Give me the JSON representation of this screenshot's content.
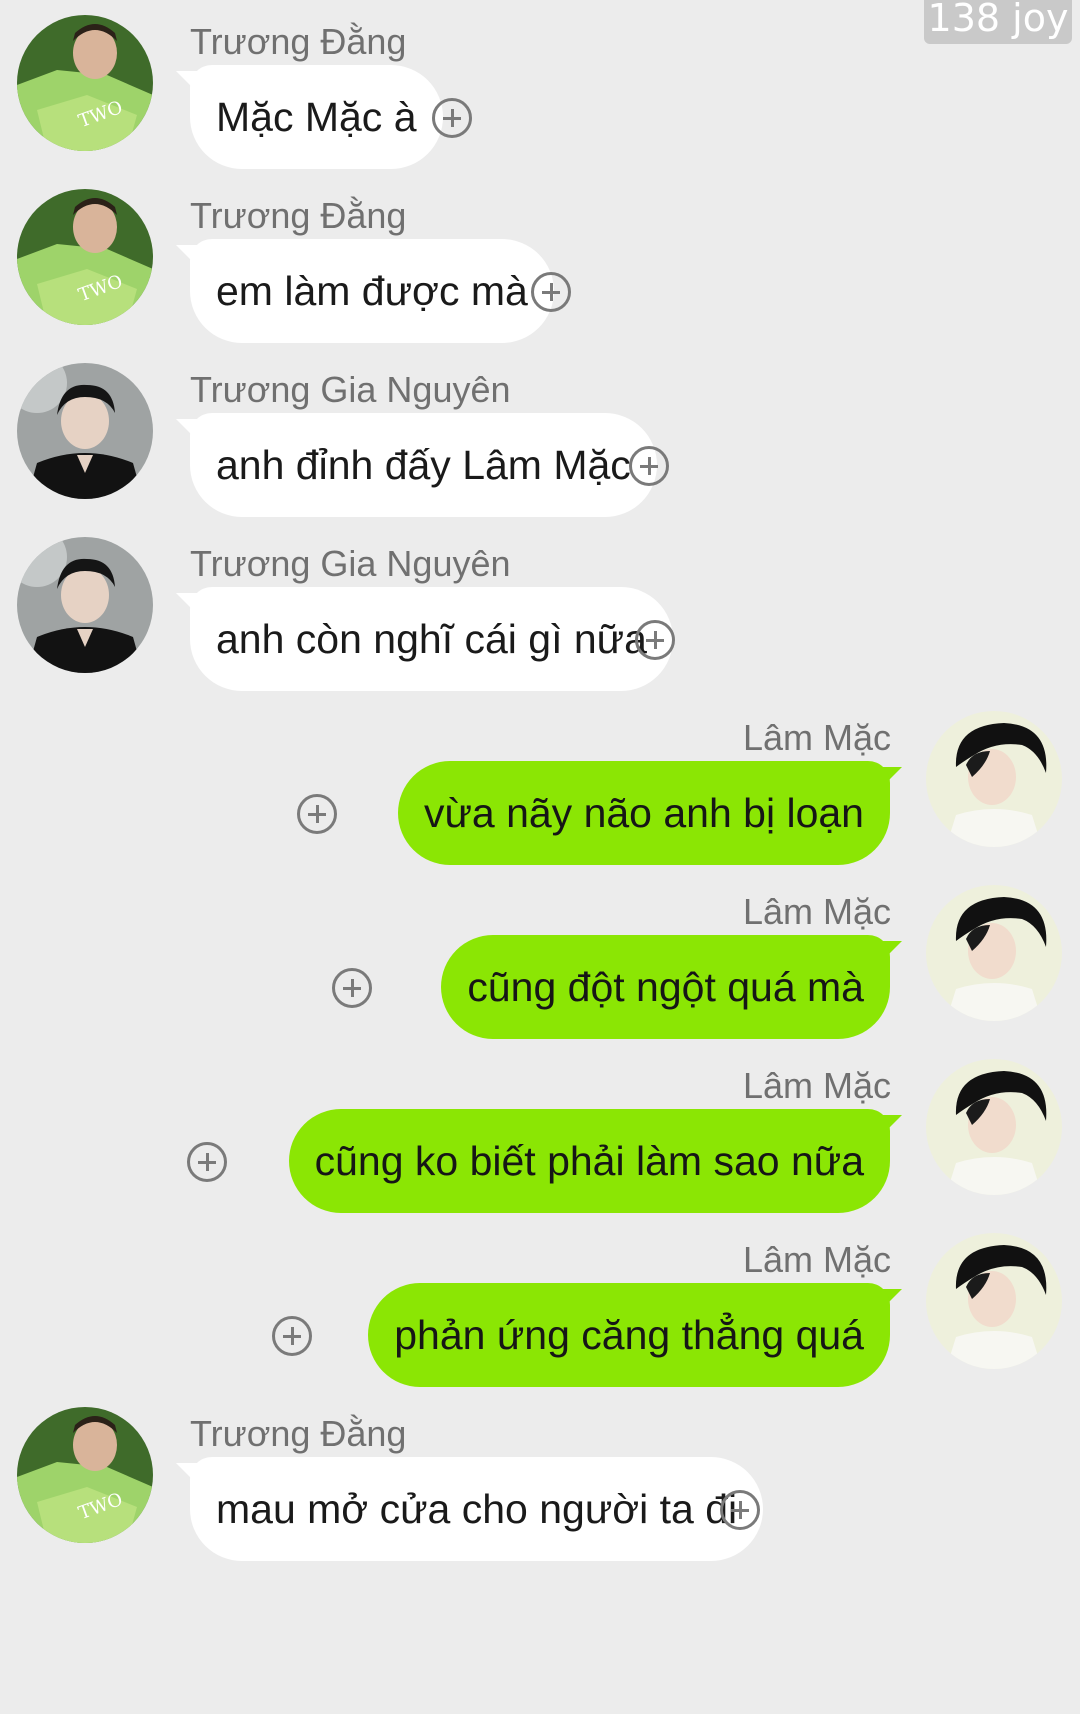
{
  "watermark": "138 joy",
  "messages": [
    {
      "sender": "Trương Đằng",
      "text": "Mặc Mặc à",
      "side": "left",
      "avatar": "avatar-truong-dang"
    },
    {
      "sender": "Trương Đằng",
      "text": "em làm được mà",
      "side": "left",
      "avatar": "avatar-truong-dang"
    },
    {
      "sender": "Trương Gia Nguyên",
      "text": "anh đỉnh đấy Lâm Mặc",
      "side": "left",
      "avatar": "avatar-truong-gia-nguyen"
    },
    {
      "sender": "Trương Gia Nguyên",
      "text": "anh còn nghĩ cái gì nữa",
      "side": "left",
      "avatar": "avatar-truong-gia-nguyen"
    },
    {
      "sender": "Lâm Mặc",
      "text": "vừa nãy não anh bị loạn",
      "side": "right",
      "avatar": "avatar-lam-mac"
    },
    {
      "sender": "Lâm Mặc",
      "text": "cũng đột ngột quá mà",
      "side": "right",
      "avatar": "avatar-lam-mac"
    },
    {
      "sender": "Lâm Mặc",
      "text": "cũng ko biết phải làm sao nữa",
      "side": "right",
      "avatar": "avatar-lam-mac"
    },
    {
      "sender": "Lâm Mặc",
      "text": "phản ứng căng thẳng quá",
      "side": "right",
      "avatar": "avatar-lam-mac"
    },
    {
      "sender": "Trương Đằng",
      "text": "mau mở cửa cho người ta đi",
      "side": "left",
      "avatar": "avatar-truong-dang"
    }
  ],
  "colors": {
    "background": "#ececec",
    "incoming_bubble": "#ffffff",
    "outgoing_bubble": "#8be604",
    "sender_text": "#707070"
  },
  "icons": {
    "react": "plus-circle-icon"
  }
}
